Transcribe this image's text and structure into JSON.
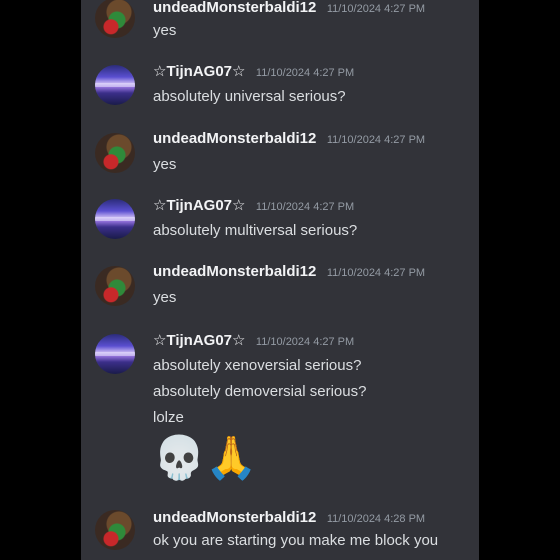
{
  "messages": [
    {
      "author": "undeadMonsterbaldi12",
      "timestamp": "11/10/2024 4:27 PM",
      "lines": [
        "yes"
      ]
    },
    {
      "author": "☆TijnAG07☆",
      "timestamp": "11/10/2024 4:27 PM",
      "lines": [
        "absolutely universal serious?"
      ]
    },
    {
      "author": "undeadMonsterbaldi12",
      "timestamp": "11/10/2024 4:27 PM",
      "lines": [
        "yes"
      ]
    },
    {
      "author": "☆TijnAG07☆",
      "timestamp": "11/10/2024 4:27 PM",
      "lines": [
        "absolutely multiversal serious?"
      ]
    },
    {
      "author": "undeadMonsterbaldi12",
      "timestamp": "11/10/2024 4:27 PM",
      "lines": [
        "yes"
      ]
    },
    {
      "author": "☆TijnAG07☆",
      "timestamp": "11/10/2024 4:27 PM",
      "lines": [
        "absolutely xenoversial serious?",
        "absolutely demoversial serious?",
        "lolze"
      ],
      "emojis": [
        "skull-emoji",
        "folded-hands-emoji"
      ]
    },
    {
      "author": "undeadMonsterbaldi12",
      "timestamp": "11/10/2024 4:28 PM",
      "lines": [
        "ok you are starting you make me block you"
      ]
    }
  ]
}
